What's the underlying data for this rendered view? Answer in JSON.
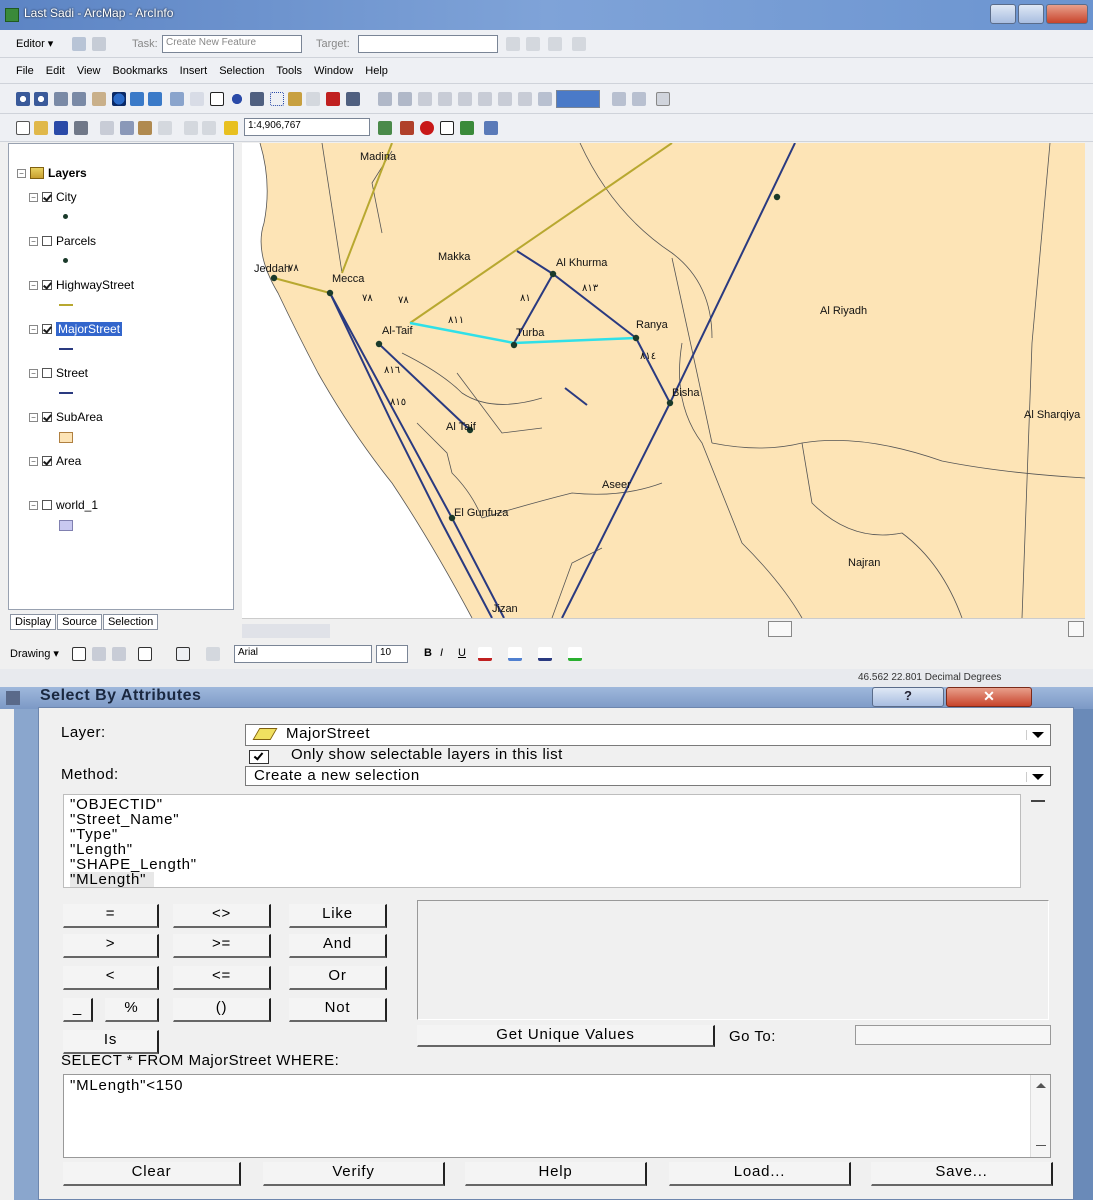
{
  "window": {
    "title": "Last Sadi - ArcMap - ArcInfo"
  },
  "editor_toolbar": {
    "editor_label": "Editor ▾",
    "task_label": "Task:",
    "task_value": "Create New Feature",
    "target_label": "Target:"
  },
  "menu": {
    "items": [
      "File",
      "Edit",
      "View",
      "Bookmarks",
      "Insert",
      "Selection",
      "Tools",
      "Window",
      "Help"
    ]
  },
  "standard_toolbar": {
    "scale": "1:4,906,767"
  },
  "toc": {
    "root_label": "Layers",
    "layers": [
      {
        "name": "City",
        "checked": true,
        "symbol": "point"
      },
      {
        "name": "Parcels",
        "checked": false,
        "symbol": "point"
      },
      {
        "name": "HighwayStreet",
        "checked": true,
        "symbol": "line-olive"
      },
      {
        "name": "MajorStreet",
        "checked": true,
        "symbol": "line-navy",
        "selected": true
      },
      {
        "name": "Street",
        "checked": false,
        "symbol": "line-navy"
      },
      {
        "name": "SubArea",
        "checked": true,
        "symbol": "poly-orange"
      },
      {
        "name": "Area",
        "checked": true,
        "symbol": "none"
      },
      {
        "name": "world_1",
        "checked": false,
        "symbol": "poly-lavender"
      }
    ],
    "tabs": [
      "Display",
      "Source",
      "Selection"
    ]
  },
  "map": {
    "labels": [
      "Madina",
      "Makka",
      "Jeddah",
      "Mecca",
      "Al Khurma",
      "Al Riyadh",
      "Al-Taif",
      "Turba",
      "Ranya",
      "Bisha",
      "Al Sharqiya",
      "Al Taif",
      "Aseer",
      "El Gunfuza",
      "Najran",
      "Jizan"
    ],
    "road_codes": [
      "٧٨",
      "٧٨",
      "٧٨",
      "٨١١",
      "٨١",
      "٨١٣",
      "٨١٦",
      "٨١٥",
      "٨١٤"
    ]
  },
  "drawing_toolbar": {
    "drawing_label": "Drawing ▾",
    "font": "Arial",
    "font_size": "10"
  },
  "statusbar": {
    "coords": "46.562  22.801 Decimal Degrees"
  },
  "dialog": {
    "title": "Select By Attributes",
    "layer_label": "Layer:",
    "layer_value": "MajorStreet",
    "only_selectable_label": "Only show selectable layers in this list",
    "only_selectable_checked": true,
    "method_label": "Method:",
    "method_value": "Create a new selection",
    "fields": [
      "\"OBJECTID\"",
      "\"Street_Name\"",
      "\"Type\"",
      "\"Length\"",
      "\"SHAPE_Length\"",
      "\"MLength\""
    ],
    "operators": {
      "eq": "=",
      "ne": "<>",
      "like": "Like",
      "gt": ">",
      "ge": ">=",
      "and": "And",
      "lt": "<",
      "le": "<=",
      "or": "Or",
      "underscore": "_",
      "percent": "%",
      "parens": "()",
      "not": "Not",
      "is": "Is"
    },
    "get_unique_label": "Get Unique Values",
    "goto_label": "Go To:",
    "select_prefix": "SELECT * FROM MajorStreet WHERE:",
    "expression": "\"MLength\"<150",
    "buttons": {
      "clear": "Clear",
      "verify": "Verify",
      "help": "Help",
      "load": "Load...",
      "save": "Save..."
    }
  }
}
